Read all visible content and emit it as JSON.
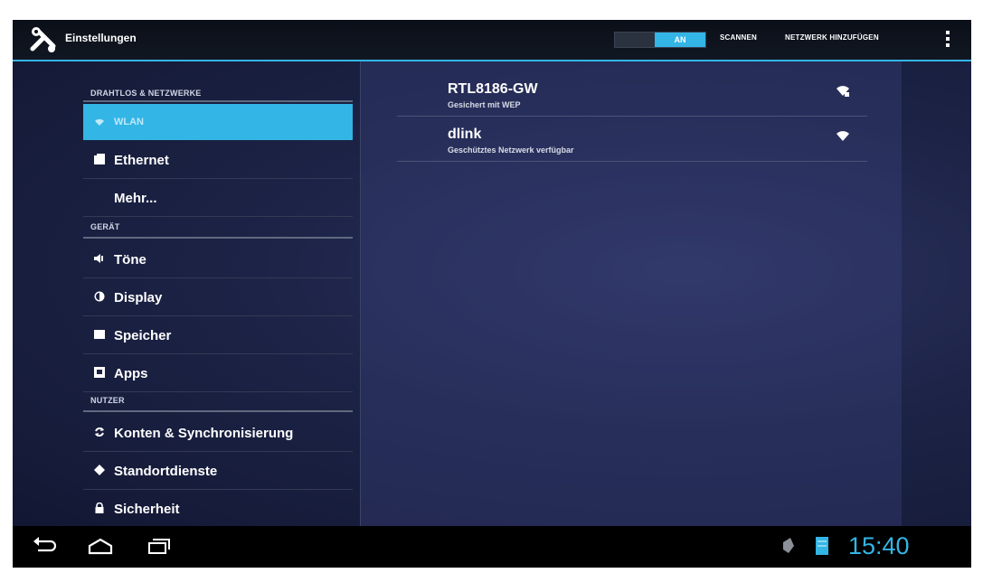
{
  "header": {
    "title": "Einstellungen",
    "wifi_toggle_label": "AN",
    "scan_label": "SCANNEN",
    "add_network_label": "NETZWERK HINZUFÜGEN",
    "logo_icon": "settings-tools-icon",
    "accent_color": "#33b5e5"
  },
  "sidebar": {
    "cat_wireless": "DRAHTLOS & NETZWERKE",
    "cat_device": "GERÄT",
    "cat_user": "NUTZER",
    "items": [
      {
        "label": "WLAN",
        "icon": "wifi-icon"
      },
      {
        "label": "Ethernet",
        "icon": "ethernet-icon"
      },
      {
        "label": "Mehr...",
        "icon": ""
      },
      {
        "label": "Töne",
        "icon": "sound-icon"
      },
      {
        "label": "Display",
        "icon": "display-icon"
      },
      {
        "label": "Speicher",
        "icon": "storage-icon"
      },
      {
        "label": "Apps",
        "icon": "apps-icon"
      },
      {
        "label": "Konten & Synchronisierung",
        "icon": "sync-icon"
      },
      {
        "label": "Standortdienste",
        "icon": "location-icon"
      },
      {
        "label": "Sicherheit",
        "icon": "lock-icon"
      }
    ]
  },
  "networks": [
    {
      "ssid": "RTL8186-GW",
      "status": "Gesichert mit WEP",
      "icon": "wifi-signal-locked-icon"
    },
    {
      "ssid": "dlink",
      "status": "Geschütztes Netzwerk verfügbar",
      "icon": "wifi-signal-icon"
    }
  ],
  "navbar": {
    "clock": "15:40",
    "icons": [
      "back-icon",
      "home-icon",
      "recent-apps-icon",
      "notification-icon",
      "battery-icon"
    ]
  }
}
